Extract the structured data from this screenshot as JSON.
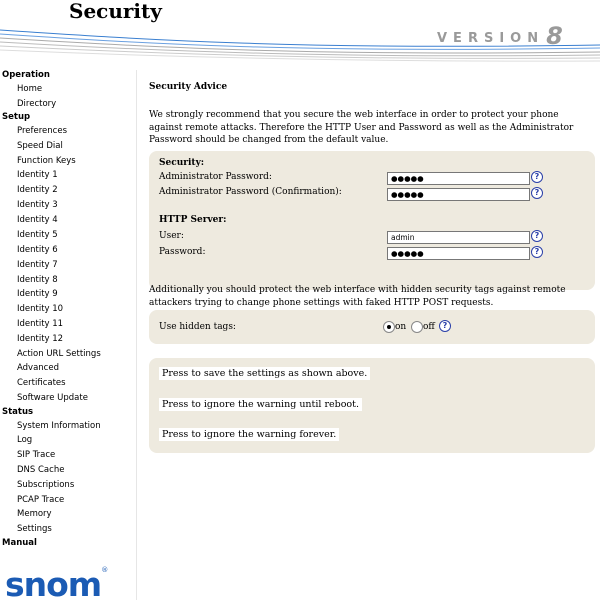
{
  "header": {
    "title": "Security",
    "version_word": "VERSION",
    "version_num": "8"
  },
  "sidebar": {
    "operation": {
      "label": "Operation",
      "items": [
        "Home",
        "Directory"
      ]
    },
    "setup": {
      "label": "Setup",
      "items": [
        "Preferences",
        "Speed Dial",
        "Function Keys",
        "Identity 1",
        "Identity 2",
        "Identity 3",
        "Identity 4",
        "Identity 5",
        "Identity 6",
        "Identity 7",
        "Identity 8",
        "Identity 9",
        "Identity 10",
        "Identity 11",
        "Identity 12",
        "Action URL Settings",
        "Advanced",
        "Certificates",
        "Software Update"
      ]
    },
    "status": {
      "label": "Status",
      "items": [
        "System Information",
        "Log",
        "SIP Trace",
        "DNS Cache",
        "Subscriptions",
        "PCAP Trace",
        "Memory",
        "Settings"
      ]
    },
    "manual": {
      "label": "Manual"
    }
  },
  "logo": {
    "text": "snom",
    "reg": "®"
  },
  "main": {
    "heading": "Security Advice",
    "intro": "We strongly recommend that you secure the web interface in order to protect your phone against remote attacks. Therefore the HTTP User and Password as well as the Administrator Password should be changed from the default value.",
    "security": {
      "title": "Security:",
      "admin_pw_label": "Administrator Password:",
      "admin_pw_value": "●●●●●",
      "admin_pw_confirm_label": "Administrator Password (Confirmation):",
      "admin_pw_confirm_value": "●●●●●"
    },
    "http": {
      "title": "HTTP Server:",
      "user_label": "User:",
      "user_value": "admin",
      "password_label": "Password:",
      "password_value": "●●●●●"
    },
    "para2": "Additionally you should protect the web interface with hidden security tags against remote attackers trying to change phone settings with faked HTTP POST requests.",
    "hidden_tags": {
      "label": "Use hidden tags:",
      "on": "on",
      "off": "off",
      "selected": "on"
    },
    "buttons": {
      "save": "Press to save the settings as shown above.",
      "ignore_reboot": "Press to ignore the warning until reboot.",
      "ignore_forever": "Press to ignore the warning forever."
    },
    "help_glyph": "?"
  }
}
